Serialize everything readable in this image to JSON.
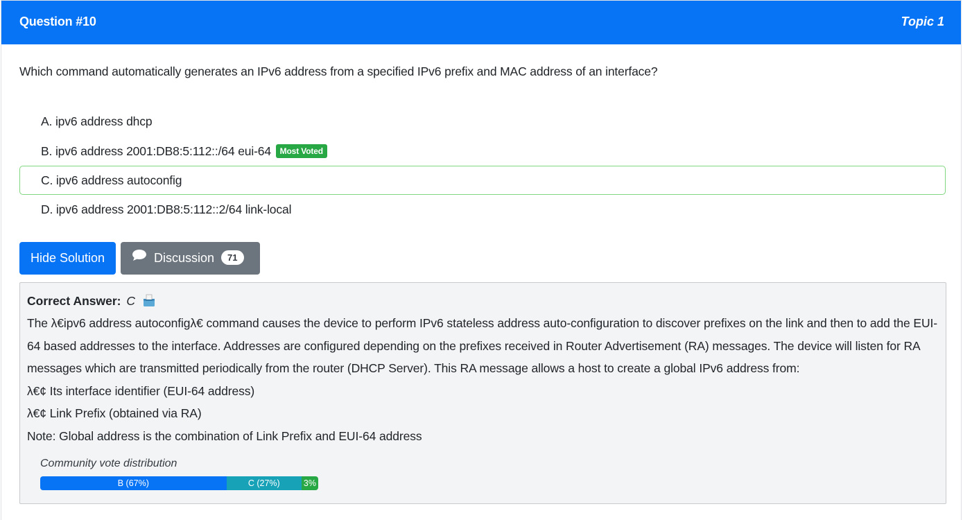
{
  "header": {
    "question": "Question #10",
    "topic": "Topic 1"
  },
  "question_text": "Which command automatically generates an IPv6 address from a specified IPv6 prefix and MAC address of an interface?",
  "choices": [
    {
      "text": "A. ipv6 address dhcp"
    },
    {
      "text": "B. ipv6 address 2001:DB8:5:112::/64 eui-64",
      "badge": "Most Voted"
    },
    {
      "text": "C. ipv6 address autoconfig"
    },
    {
      "text": "D. ipv6 address 2001:DB8:5:112::2/64 link-local"
    }
  ],
  "buttons": {
    "hide_solution": "Hide Solution",
    "discussion": "Discussion",
    "discussion_count": "71"
  },
  "answer": {
    "label": "Correct Answer:",
    "letter": "C",
    "icon": "ballot-box-icon",
    "lines": [
      "The λ€ipv6 address autoconfigλ€ command causes the device to perform IPv6 stateless address auto-configuration to discover prefixes on the link and then to add the EUI-64 based addresses to the interface. Addresses are configured depending on the prefixes received in Router Advertisement (RA) messages. The device will listen for RA messages which are transmitted periodically from the router (DHCP Server). This RA message allows a host to create a global IPv6 address from:",
      "λ€¢ Its interface identifier (EUI-64 address)",
      "λ€¢ Link Prefix (obtained via RA)",
      "Note: Global address is the combination of Link Prefix and EUI-64 address"
    ]
  },
  "votes": {
    "title": "Community vote distribution",
    "segments": [
      {
        "label": "B (67%)",
        "percent": 67,
        "color": "#0773f5"
      },
      {
        "label": "C (27%)",
        "percent": 27,
        "color": "#17a2b8"
      },
      {
        "label": "3%",
        "percent": 6,
        "color": "#28a745"
      }
    ]
  },
  "colors": {
    "primary": "#0773f5",
    "secondary": "#6c757d",
    "success": "#28a745",
    "info": "#17a2b8"
  }
}
